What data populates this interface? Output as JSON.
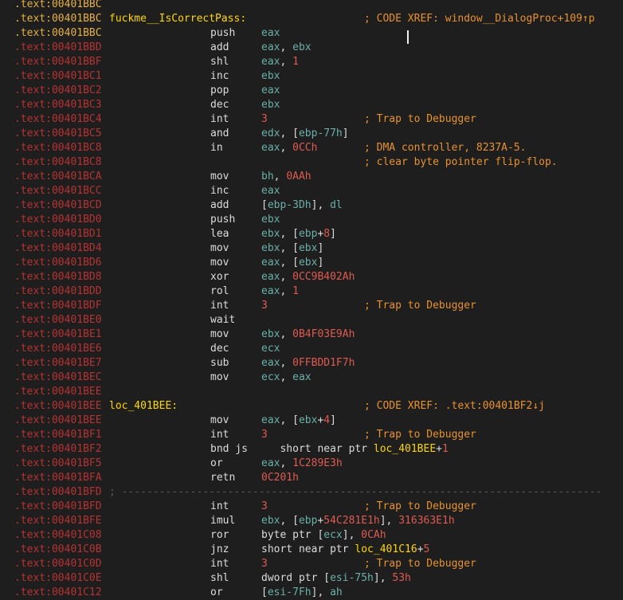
{
  "lines": [
    {
      "addr": ".text:00401BBC",
      "addr_style": "normal"
    },
    {
      "addr": ".text:00401BBC",
      "addr_style": "normal",
      "label": "fuckme__IsCorrectPass:",
      "comment": "; CODE XREF: window__DialogProc+109↑p"
    },
    {
      "addr": ".text:00401BBC",
      "addr_style": "normal",
      "mnemonic": "push",
      "operands": [
        {
          "t": "eax",
          "k": "r"
        }
      ]
    },
    {
      "addr": ".text:00401BBD",
      "addr_style": "red",
      "mnemonic": "add",
      "operands": [
        {
          "t": "eax",
          "k": "r"
        },
        {
          "t": ", "
        },
        {
          "t": "ebx",
          "k": "r"
        }
      ]
    },
    {
      "addr": ".text:00401BBF",
      "addr_style": "red",
      "mnemonic": "shl",
      "operands": [
        {
          "t": "eax",
          "k": "r"
        },
        {
          "t": ", "
        },
        {
          "t": "1",
          "k": "n"
        }
      ]
    },
    {
      "addr": ".text:00401BC1",
      "addr_style": "red",
      "mnemonic": "inc",
      "operands": [
        {
          "t": "ebx",
          "k": "r"
        }
      ]
    },
    {
      "addr": ".text:00401BC2",
      "addr_style": "red",
      "mnemonic": "pop",
      "operands": [
        {
          "t": "eax",
          "k": "r"
        }
      ]
    },
    {
      "addr": ".text:00401BC3",
      "addr_style": "red",
      "mnemonic": "dec",
      "operands": [
        {
          "t": "ebx",
          "k": "r"
        }
      ]
    },
    {
      "addr": ".text:00401BC4",
      "addr_style": "red",
      "mnemonic": "int",
      "operands": [
        {
          "t": "3",
          "k": "n"
        }
      ],
      "comment": "; Trap to Debugger"
    },
    {
      "addr": ".text:00401BC5",
      "addr_style": "red",
      "mnemonic": "and",
      "operands": [
        {
          "t": "edx",
          "k": "r"
        },
        {
          "t": ", ["
        },
        {
          "t": "ebp-77h",
          "k": "r"
        },
        {
          "t": "]"
        }
      ]
    },
    {
      "addr": ".text:00401BC8",
      "addr_style": "red",
      "mnemonic": "in",
      "operands": [
        {
          "t": "eax",
          "k": "r"
        },
        {
          "t": ", "
        },
        {
          "t": "0CCh",
          "k": "n"
        }
      ],
      "comment": "; DMA controller, 8237A-5."
    },
    {
      "addr": ".text:00401BC8",
      "addr_style": "red",
      "comment": "; clear byte pointer flip-flop."
    },
    {
      "addr": ".text:00401BCA",
      "addr_style": "red",
      "mnemonic": "mov",
      "operands": [
        {
          "t": "bh",
          "k": "r"
        },
        {
          "t": ", "
        },
        {
          "t": "0AAh",
          "k": "n"
        }
      ]
    },
    {
      "addr": ".text:00401BCC",
      "addr_style": "red",
      "mnemonic": "inc",
      "operands": [
        {
          "t": "eax",
          "k": "r"
        }
      ]
    },
    {
      "addr": ".text:00401BCD",
      "addr_style": "red",
      "mnemonic": "add",
      "operands": [
        {
          "t": "["
        },
        {
          "t": "ebp-3Dh",
          "k": "r"
        },
        {
          "t": "], "
        },
        {
          "t": "dl",
          "k": "r"
        }
      ]
    },
    {
      "addr": ".text:00401BD0",
      "addr_style": "red",
      "mnemonic": "push",
      "operands": [
        {
          "t": "ebx",
          "k": "r"
        }
      ]
    },
    {
      "addr": ".text:00401BD1",
      "addr_style": "red",
      "mnemonic": "lea",
      "operands": [
        {
          "t": "ebx",
          "k": "r"
        },
        {
          "t": ", ["
        },
        {
          "t": "ebp",
          "k": "r"
        },
        {
          "t": "+"
        },
        {
          "t": "8",
          "k": "n"
        },
        {
          "t": "]"
        }
      ]
    },
    {
      "addr": ".text:00401BD4",
      "addr_style": "red",
      "mnemonic": "mov",
      "operands": [
        {
          "t": "ebx",
          "k": "r"
        },
        {
          "t": ", ["
        },
        {
          "t": "ebx",
          "k": "r"
        },
        {
          "t": "]"
        }
      ]
    },
    {
      "addr": ".text:00401BD6",
      "addr_style": "red",
      "mnemonic": "mov",
      "operands": [
        {
          "t": "eax",
          "k": "r"
        },
        {
          "t": ", ["
        },
        {
          "t": "ebx",
          "k": "r"
        },
        {
          "t": "]"
        }
      ]
    },
    {
      "addr": ".text:00401BD8",
      "addr_style": "red",
      "mnemonic": "xor",
      "operands": [
        {
          "t": "eax",
          "k": "r"
        },
        {
          "t": ", "
        },
        {
          "t": "0CC9B402Ah",
          "k": "n"
        }
      ]
    },
    {
      "addr": ".text:00401BDD",
      "addr_style": "red",
      "mnemonic": "rol",
      "operands": [
        {
          "t": "eax",
          "k": "r"
        },
        {
          "t": ", "
        },
        {
          "t": "1",
          "k": "n"
        }
      ]
    },
    {
      "addr": ".text:00401BDF",
      "addr_style": "red",
      "mnemonic": "int",
      "operands": [
        {
          "t": "3",
          "k": "n"
        }
      ],
      "comment": "; Trap to Debugger"
    },
    {
      "addr": ".text:00401BE0",
      "addr_style": "red",
      "mnemonic": "wait"
    },
    {
      "addr": ".text:00401BE1",
      "addr_style": "red",
      "mnemonic": "mov",
      "operands": [
        {
          "t": "ebx",
          "k": "r"
        },
        {
          "t": ", "
        },
        {
          "t": "0B4F03E9Ah",
          "k": "n"
        }
      ]
    },
    {
      "addr": ".text:00401BE6",
      "addr_style": "red",
      "mnemonic": "dec",
      "operands": [
        {
          "t": "ecx",
          "k": "r"
        }
      ]
    },
    {
      "addr": ".text:00401BE7",
      "addr_style": "red",
      "mnemonic": "sub",
      "operands": [
        {
          "t": "eax",
          "k": "r"
        },
        {
          "t": ", "
        },
        {
          "t": "0FFBDD1F7h",
          "k": "n"
        }
      ]
    },
    {
      "addr": ".text:00401BEC",
      "addr_style": "red",
      "mnemonic": "mov",
      "operands": [
        {
          "t": "ecx",
          "k": "r"
        },
        {
          "t": ", "
        },
        {
          "t": "eax",
          "k": "r"
        }
      ]
    },
    {
      "addr": ".text:00401BEE",
      "addr_style": "red"
    },
    {
      "addr": ".text:00401BEE",
      "addr_style": "red",
      "label": "loc_401BEE:",
      "comment": "; CODE XREF: .text:00401BF2↓j"
    },
    {
      "addr": ".text:00401BEE",
      "addr_style": "red",
      "mnemonic": "mov",
      "operands": [
        {
          "t": "eax",
          "k": "r"
        },
        {
          "t": ", ["
        },
        {
          "t": "ebx",
          "k": "r"
        },
        {
          "t": "+"
        },
        {
          "t": "4",
          "k": "n"
        },
        {
          "t": "]"
        }
      ]
    },
    {
      "addr": ".text:00401BF1",
      "addr_style": "red",
      "mnemonic": "int",
      "operands": [
        {
          "t": "3",
          "k": "n"
        }
      ],
      "comment": "; Trap to Debugger"
    },
    {
      "addr": ".text:00401BF2",
      "addr_style": "red",
      "mnemonic": "bnd js",
      "operands": [
        {
          "t": "   short near ptr "
        },
        {
          "t": "loc_401BEE",
          "k": "l"
        },
        {
          "t": "+"
        },
        {
          "t": "1",
          "k": "n"
        }
      ]
    },
    {
      "addr": ".text:00401BF5",
      "addr_style": "red",
      "mnemonic": "or",
      "operands": [
        {
          "t": "eax",
          "k": "r"
        },
        {
          "t": ", "
        },
        {
          "t": "1C289E3h",
          "k": "n"
        }
      ]
    },
    {
      "addr": ".text:00401BFA",
      "addr_style": "red",
      "mnemonic": "retn",
      "operands": [
        {
          "t": "0C201h",
          "k": "n"
        }
      ]
    },
    {
      "addr": ".text:00401BFD",
      "addr_style": "red",
      "separator": "; -----------------------------------------------------------------------------"
    },
    {
      "addr": ".text:00401BFD",
      "addr_style": "red",
      "mnemonic": "int",
      "operands": [
        {
          "t": "3",
          "k": "n"
        }
      ],
      "comment": "; Trap to Debugger"
    },
    {
      "addr": ".text:00401BFE",
      "addr_style": "red",
      "mnemonic": "imul",
      "operands": [
        {
          "t": "ebx",
          "k": "r"
        },
        {
          "t": ", ["
        },
        {
          "t": "ebp",
          "k": "r"
        },
        {
          "t": "+"
        },
        {
          "t": "54C281E1h",
          "k": "n"
        },
        {
          "t": "], "
        },
        {
          "t": "316363E1h",
          "k": "n"
        }
      ]
    },
    {
      "addr": ".text:00401C08",
      "addr_style": "red",
      "mnemonic": "ror",
      "operands": [
        {
          "t": "byte ptr ["
        },
        {
          "t": "ecx",
          "k": "r"
        },
        {
          "t": "], "
        },
        {
          "t": "0CAh",
          "k": "n"
        }
      ]
    },
    {
      "addr": ".text:00401C0B",
      "addr_style": "red",
      "mnemonic": "jnz",
      "operands": [
        {
          "t": "short near ptr "
        },
        {
          "t": "loc_401C16",
          "k": "l"
        },
        {
          "t": "+"
        },
        {
          "t": "5",
          "k": "n"
        }
      ]
    },
    {
      "addr": ".text:00401C0D",
      "addr_style": "red",
      "mnemonic": "int",
      "operands": [
        {
          "t": "3",
          "k": "n"
        }
      ],
      "comment": "; Trap to Debugger"
    },
    {
      "addr": ".text:00401C0E",
      "addr_style": "red",
      "mnemonic": "shl",
      "operands": [
        {
          "t": "dword ptr ["
        },
        {
          "t": "esi-75h",
          "k": "r"
        },
        {
          "t": "], "
        },
        {
          "t": "53h",
          "k": "n"
        }
      ]
    },
    {
      "addr": ".text:00401C12",
      "addr_style": "red",
      "mnemonic": "or",
      "operands": [
        {
          "t": "["
        },
        {
          "t": "esi-7Fh",
          "k": "r"
        },
        {
          "t": "], "
        },
        {
          "t": "ah",
          "k": "r"
        }
      ]
    }
  ]
}
